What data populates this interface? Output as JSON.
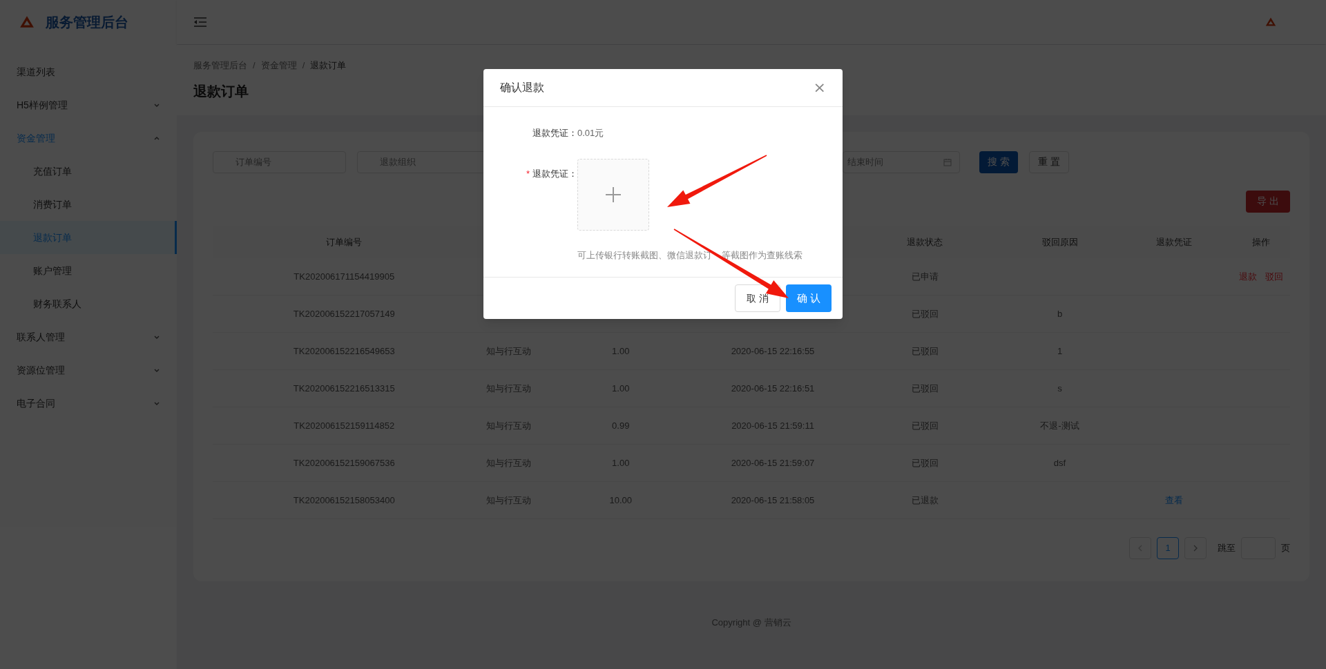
{
  "brand": {
    "title": "服务管理后台"
  },
  "sidebar": {
    "items": [
      {
        "label": "渠道列表",
        "selected": false
      },
      {
        "label": "H5样例管理",
        "selected": false,
        "expanded": false
      },
      {
        "label": "资金管理",
        "selected": true,
        "expanded": true,
        "children": [
          {
            "label": "充值订单",
            "selected": false
          },
          {
            "label": "消费订单",
            "selected": false
          },
          {
            "label": "退款订单",
            "selected": true
          },
          {
            "label": "账户管理",
            "selected": false
          },
          {
            "label": "财务联系人",
            "selected": false
          }
        ]
      },
      {
        "label": "联系人管理",
        "selected": false,
        "expanded": false
      },
      {
        "label": "资源位管理",
        "selected": false,
        "expanded": false
      },
      {
        "label": "电子合同",
        "selected": false,
        "expanded": false
      }
    ]
  },
  "breadcrumb": [
    "服务管理后台",
    "资金管理",
    "退款订单"
  ],
  "breadcrumb_separator": "/",
  "page_title": "退款订单",
  "filters": {
    "fields": [
      {
        "placeholder": "订单编号"
      },
      {
        "placeholder": "退款组织"
      }
    ],
    "end_date": {
      "placeholder": "结束时间"
    },
    "search_button": "搜 索",
    "reset_button": "重 置"
  },
  "export_button": "导 出",
  "table": {
    "columns": {
      "order_no": "订单编号",
      "status": "退款状态",
      "reason": "驳回原因",
      "voucher": "退款凭证",
      "actions": "操作"
    },
    "rows": [
      {
        "order_no": "TK202006171154419905",
        "status": "已申请",
        "actions": [
          "退款",
          "驳回"
        ]
      },
      {
        "order_no": "TK202006152217057149",
        "status": "已驳回",
        "reason": "b"
      },
      {
        "order_no": "TK202006152216549653",
        "org": "知与行互动",
        "amount": "1.00",
        "time": "2020-06-15 22:16:55",
        "status": "已驳回",
        "reason": "1"
      },
      {
        "order_no": "TK202006152216513315",
        "org": "知与行互动",
        "amount": "1.00",
        "time": "2020-06-15 22:16:51",
        "status": "已驳回",
        "reason": "s"
      },
      {
        "order_no": "TK202006152159114852",
        "org": "知与行互动",
        "amount": "0.99",
        "time": "2020-06-15 21:59:11",
        "status": "已驳回",
        "reason": "不退-测试"
      },
      {
        "order_no": "TK202006152159067536",
        "org": "知与行互动",
        "amount": "1.00",
        "time": "2020-06-15 21:59:07",
        "status": "已驳回",
        "reason": "dsf"
      },
      {
        "order_no": "TK202006152158053400",
        "org": "知与行互动",
        "amount": "10.00",
        "time": "2020-06-15 21:58:05",
        "status": "已退款",
        "voucher": "查看"
      }
    ]
  },
  "pagination": {
    "pages": [
      {
        "label": "1",
        "selected": true
      }
    ],
    "jump_label": "跳至",
    "page_suffix": "页"
  },
  "footer": "Copyright @ 营销云",
  "modal": {
    "title": "确认退款",
    "close": "×",
    "amount_label": "退款凭证：",
    "amount_value": "0.01元",
    "upload_label": "退款凭证：",
    "required_mark": "*",
    "hint_parts": [
      "可上传银行转账截图、微信退款订",
      "等截图作为查账线索"
    ],
    "cancel": "取 消",
    "confirm": "确 认"
  }
}
